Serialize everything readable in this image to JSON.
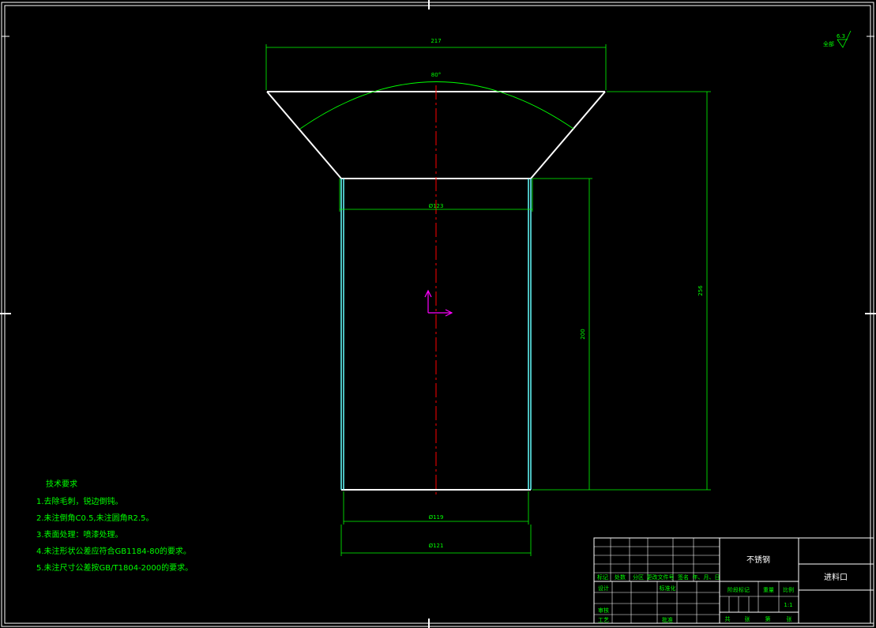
{
  "dimensions": {
    "top_width": "217",
    "angle": "80°",
    "upper_dia": "Ø123",
    "total_height": "256",
    "body_height": "200",
    "inner_dia": "Ø119",
    "outer_dia": "Ø121"
  },
  "roughness": {
    "prefix": "全部",
    "value": "6.3"
  },
  "notes": {
    "title": "技术要求",
    "items": [
      "1.去除毛刺，锐边倒钝。",
      "2.未注倒角C0.5,未注圆角R2.5。",
      "3.表面处理：喷漆处理。",
      "4.未注形状公差应符合GB1184-80的要求。",
      "5.未注尺寸公差按GB/T1804-2000的要求。"
    ]
  },
  "title_block": {
    "material": "不锈钢",
    "part_name": "进料口",
    "scale_value": "1:1",
    "header_cells": [
      "标记",
      "处数",
      "分区",
      "更改文件号",
      "签名",
      "年、月、日"
    ],
    "design": "设计",
    "standardize": "标准化",
    "review": "审核",
    "process": "工艺",
    "approve": "批准",
    "stage_mark": "阶段标记",
    "weight": "重量",
    "scale": "比例",
    "sheet_cells": [
      "共",
      "张",
      "第",
      "张"
    ]
  }
}
